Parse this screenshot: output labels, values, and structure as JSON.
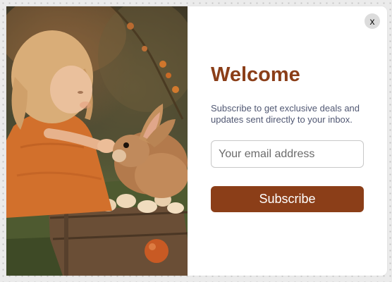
{
  "popup": {
    "close_label": "x",
    "title": "Welcome",
    "subtitle": "Subscribe to get exclusive deals and updates sent directly to your inbox.",
    "email_placeholder": "Your email address",
    "email_value": "",
    "subscribe_label": "Subscribe"
  },
  "hero_image": {
    "description_icon": "photo-girl-with-bunny"
  },
  "colors": {
    "brand": "#8b3e18",
    "subtitle_text": "#515873",
    "close_bg": "#dcdcdc",
    "page_bg": "#ebebeb"
  }
}
